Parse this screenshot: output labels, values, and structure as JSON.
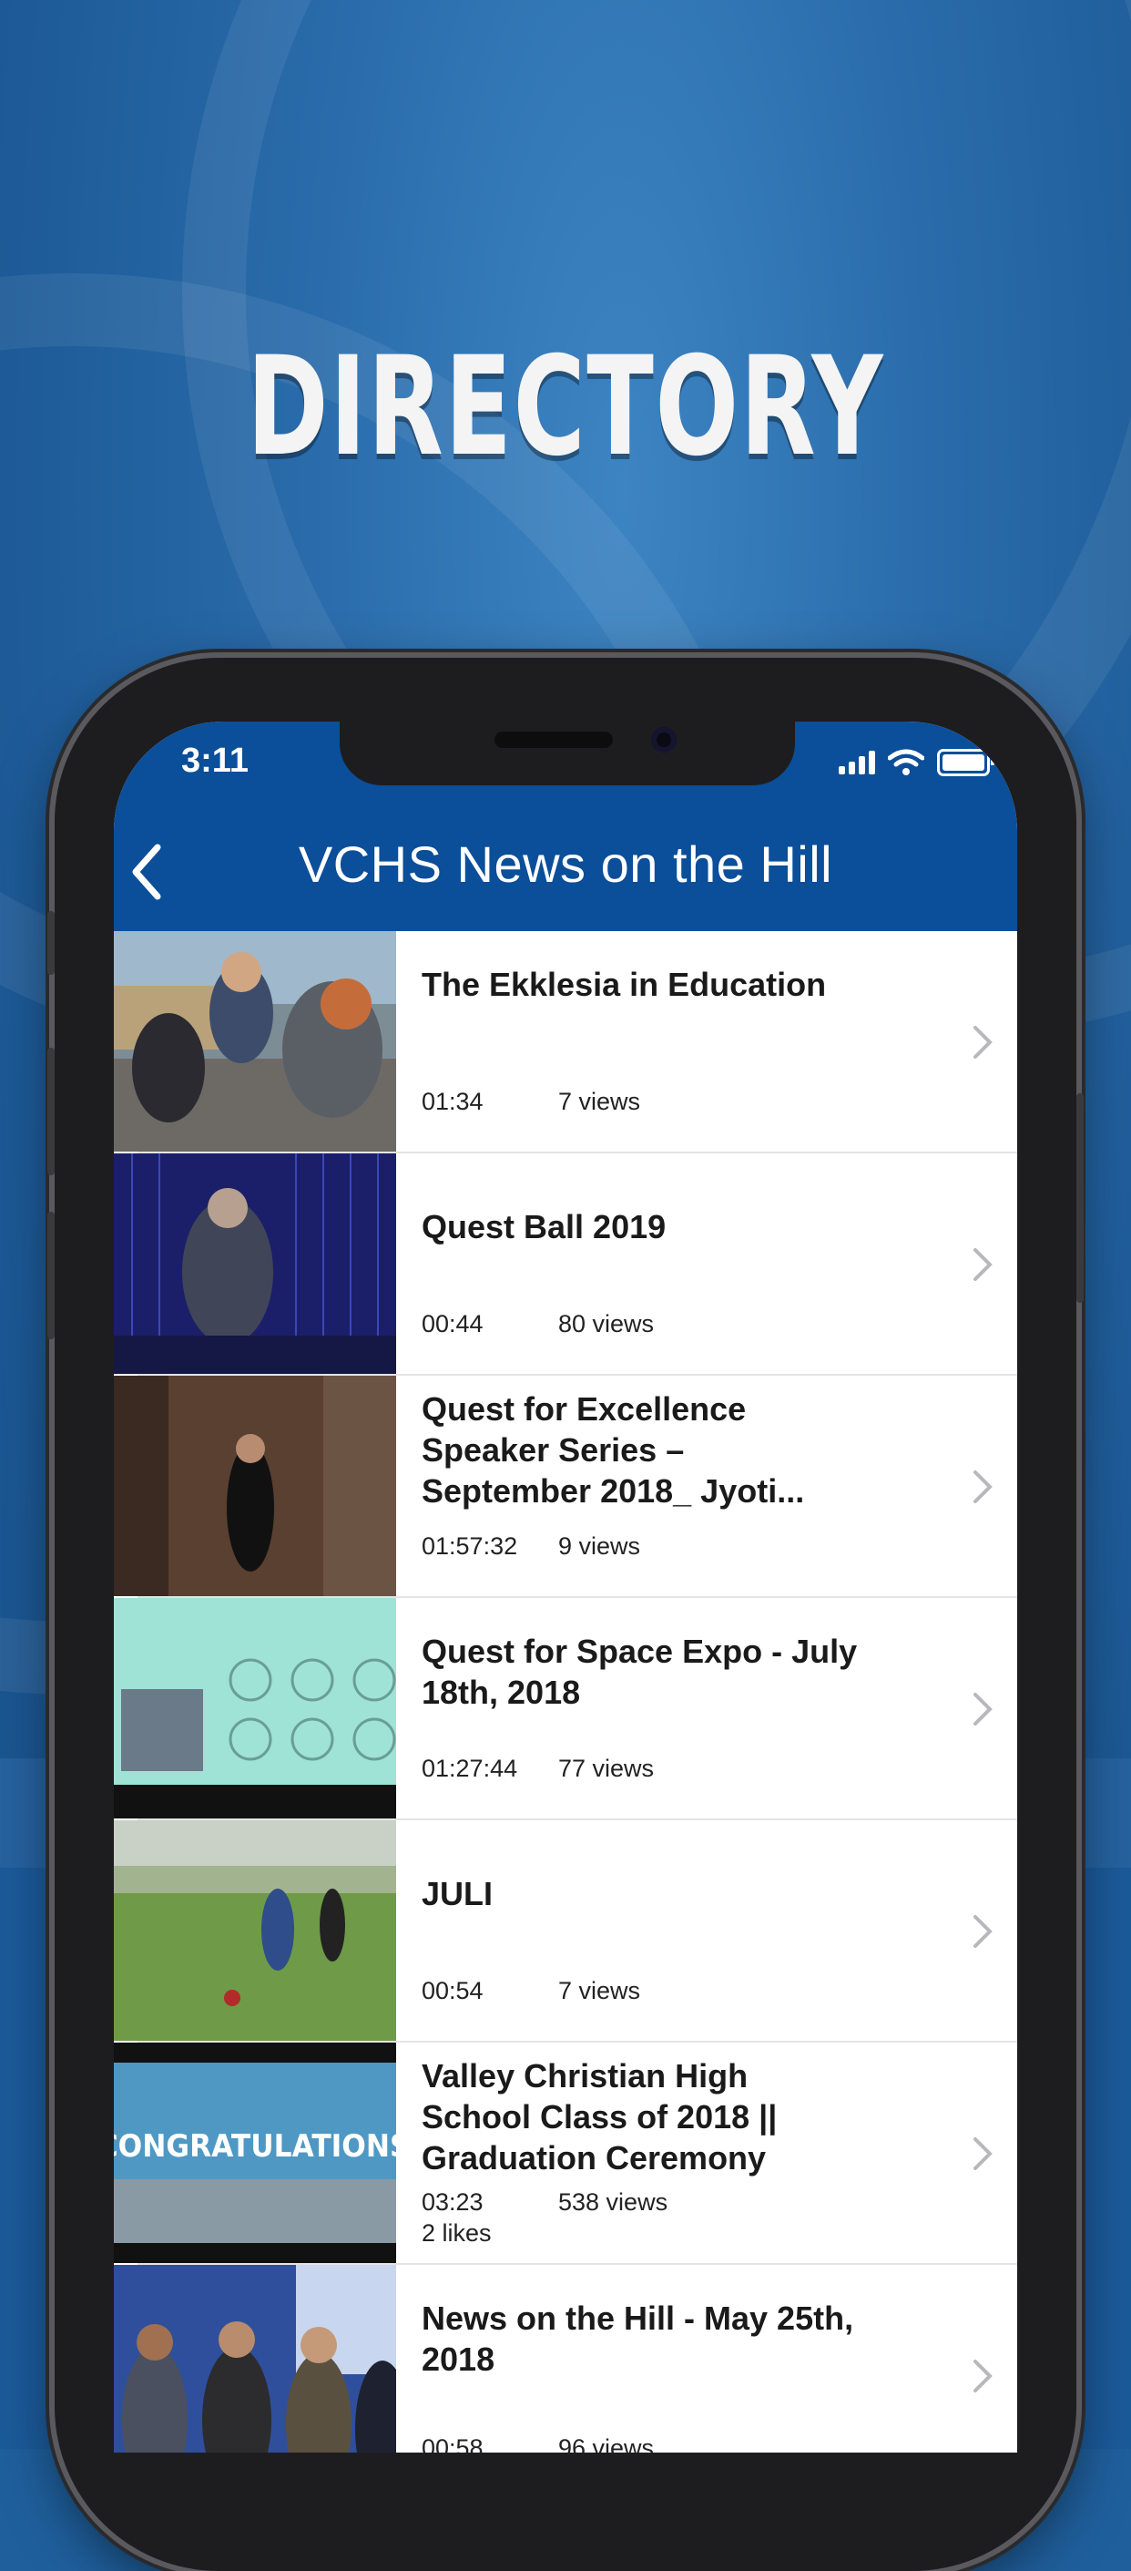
{
  "headline": "DIRECTORY",
  "status_bar": {
    "time": "3:11"
  },
  "nav": {
    "title": "VCHS News on the Hill",
    "back_icon": "chevron-left-icon"
  },
  "colors": {
    "nav_bar": "#0b4e99",
    "background": "#1f5f9c"
  },
  "videos": [
    {
      "title": "The Ekklesia in Education",
      "duration": "01:34",
      "views": "7 views"
    },
    {
      "title": "Quest Ball 2019",
      "duration": "00:44",
      "views": "80 views"
    },
    {
      "title": "Quest for Excellence Speaker Series – September 2018_ Jyoti...",
      "duration": "01:57:32",
      "views": "9 views"
    },
    {
      "title": "Quest for Space Expo - July 18th, 2018",
      "duration": "01:27:44",
      "views": "77 views"
    },
    {
      "title": "JULI",
      "duration": "00:54",
      "views": "7 views"
    },
    {
      "title": "Valley Christian High School Class of 2018 || Graduation Ceremony",
      "duration": "03:23",
      "views": "538 views",
      "likes": "2 likes"
    },
    {
      "title": "News on the Hill - May 25th, 2018",
      "duration": "00:58",
      "views": "96 views"
    }
  ],
  "thumb_text": {
    "graduation": "CONGRATULATIONS"
  }
}
